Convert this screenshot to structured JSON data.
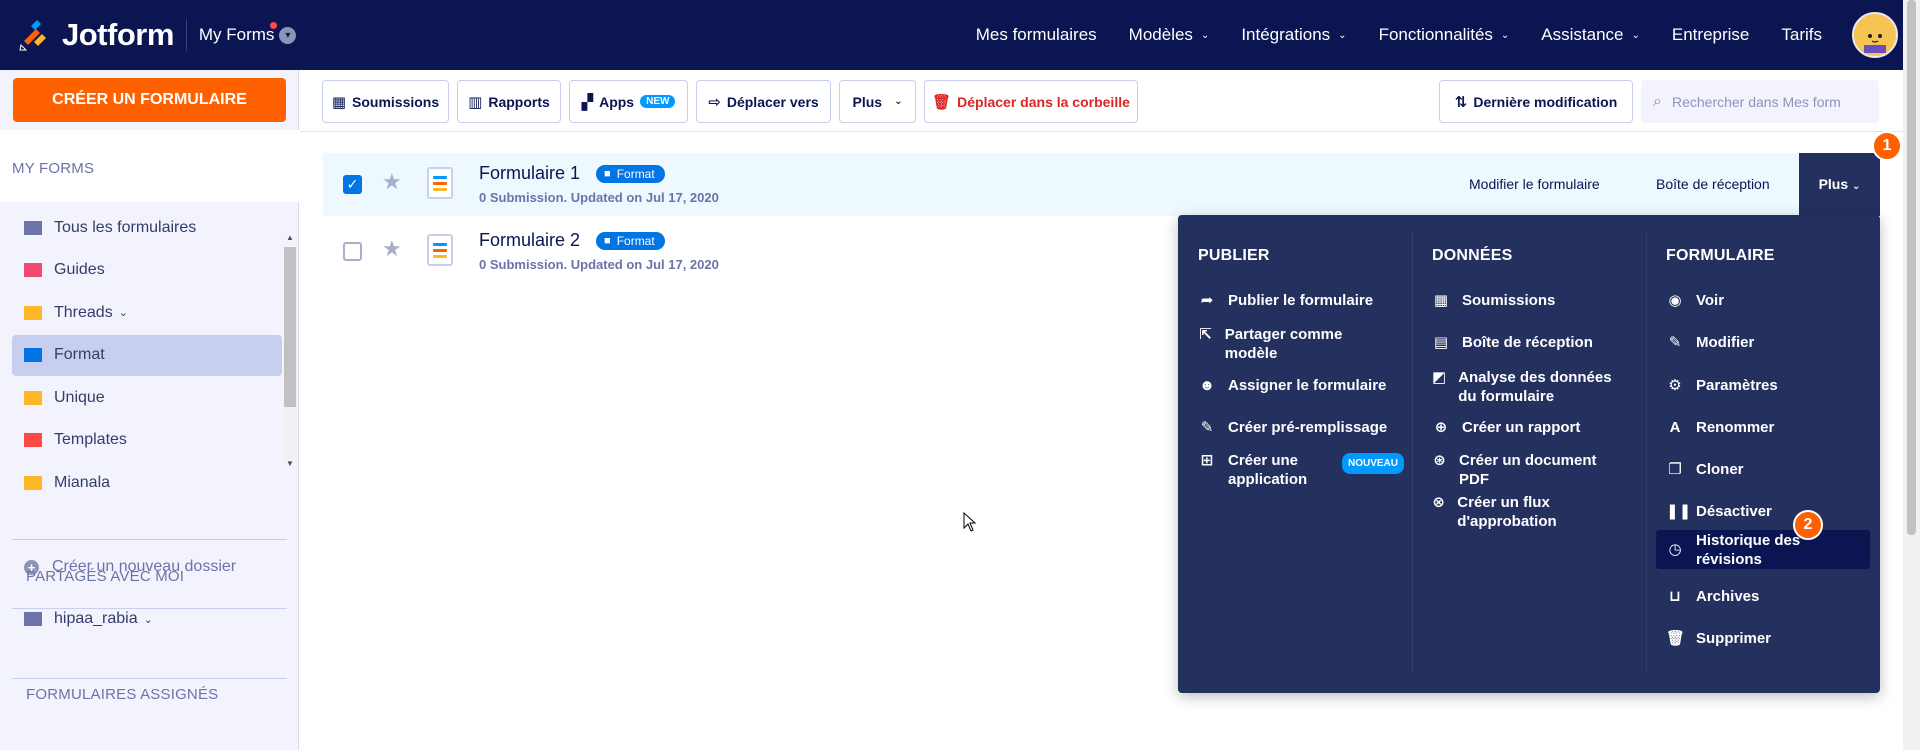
{
  "header": {
    "brand": "Jotform",
    "switcher_label": "My Forms",
    "nav": [
      {
        "label": "Mes formulaires",
        "caret": false
      },
      {
        "label": "Modèles",
        "caret": true
      },
      {
        "label": "Intégrations",
        "caret": true
      },
      {
        "label": "Fonctionnalités",
        "caret": true
      },
      {
        "label": "Assistance",
        "caret": true
      },
      {
        "label": "Entreprise",
        "caret": false
      },
      {
        "label": "Tarifs",
        "caret": false
      }
    ]
  },
  "sidebar": {
    "create_button": "CRÉER UN FORMULAIRE",
    "my_forms_title": "MY FORMS",
    "folders": [
      {
        "label": "Tous les formulaires",
        "color": "#6c73a8",
        "chev": false
      },
      {
        "label": "Guides",
        "color": "#ef4b6e",
        "chev": false
      },
      {
        "label": "Threads",
        "color": "#ffb629",
        "chev": true
      },
      {
        "label": "Format",
        "color": "#0075e3",
        "chev": false
      },
      {
        "label": "Unique",
        "color": "#ffb629",
        "chev": false
      },
      {
        "label": "Templates",
        "color": "#ff4948",
        "chev": false
      },
      {
        "label": "Mianala",
        "color": "#ffb629",
        "chev": false
      }
    ],
    "new_folder": "Créer un nouveau dossier",
    "shared_title": "PARTAGÉS AVEC MOI",
    "shared_item": "hipaa_rabia",
    "assigned_title": "FORMULAIRES ASSIGNÉS"
  },
  "toolbar": {
    "submissions": "Soumissions",
    "reports": "Rapports",
    "apps": "Apps",
    "apps_badge": "NEW",
    "move": "Déplacer vers",
    "more": "Plus",
    "trash": "Déplacer dans la corbeille",
    "sort": "Dernière modification",
    "search_placeholder": "Rechercher dans Mes form"
  },
  "forms": [
    {
      "title": "Formulaire 1",
      "folder": "Format",
      "meta": "0 Submission. Updated on Jul 17, 2020",
      "checked": true
    },
    {
      "title": "Formulaire 2",
      "folder": "Format",
      "meta": "0 Submission. Updated on Jul 17, 2020",
      "checked": false
    }
  ],
  "row_actions": {
    "edit": "Modifier le formulaire",
    "inbox": "Boîte de réception",
    "more": "Plus"
  },
  "steps": [
    "1",
    "2"
  ],
  "menu": {
    "publish_title": "PUBLIER",
    "publish": [
      {
        "label": "Publier le formulaire",
        "icon": "share-arrow-icon"
      },
      {
        "label": "Partager comme modèle",
        "icon": "export-icon"
      },
      {
        "label": "Assigner le formulaire",
        "icon": "users-icon"
      },
      {
        "label": "Créer pré-remplissage",
        "icon": "pencil-icon"
      },
      {
        "label": "Créer une application",
        "icon": "app-grid-icon",
        "badge": "NOUVEAU"
      }
    ],
    "data_title": "DONNÉES",
    "data": [
      {
        "label": "Soumissions",
        "icon": "table-icon"
      },
      {
        "label": "Boîte de réception",
        "icon": "inbox-icon"
      },
      {
        "label": "Analyse des données du formulaire",
        "icon": "analytics-icon"
      },
      {
        "label": "Créer un rapport",
        "icon": "report-icon"
      },
      {
        "label": "Créer un document PDF",
        "icon": "pdf-icon"
      },
      {
        "label": "Créer un flux d'approbation",
        "icon": "approval-icon"
      }
    ],
    "form_title": "FORMULAIRE",
    "form": [
      {
        "label": "Voir",
        "icon": "eye-icon"
      },
      {
        "label": "Modifier",
        "icon": "edit-icon"
      },
      {
        "label": "Paramètres",
        "icon": "gear-icon"
      },
      {
        "label": "Renommer",
        "icon": "rename-icon"
      },
      {
        "label": "Cloner",
        "icon": "clone-icon"
      },
      {
        "label": "Désactiver",
        "icon": "pause-icon"
      },
      {
        "label": "Historique des révisions",
        "icon": "clock-icon"
      },
      {
        "label": "Archives",
        "icon": "archive-icon"
      },
      {
        "label": "Supprimer",
        "icon": "trash-icon"
      }
    ]
  }
}
